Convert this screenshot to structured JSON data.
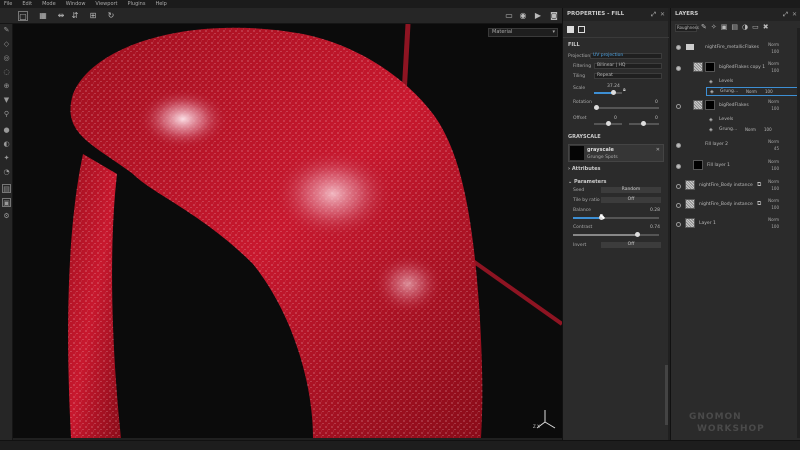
{
  "menu": [
    "File",
    "Edit",
    "Mode",
    "Window",
    "Viewport",
    "Plugins",
    "Help"
  ],
  "viewport": {
    "camera_select": "Material"
  },
  "properties": {
    "title": "PROPERTIES - FILL",
    "fill_section": "FILL",
    "projection_label": "Projection",
    "projection_value": "UV projection",
    "filtering_label": "Filtering",
    "filtering_value": "Bilinear | HQ",
    "tiling_label": "Tiling",
    "tiling_value": "Repeat",
    "scale_label": "Scale",
    "scale_value": "37.24",
    "rotation_label": "Rotation",
    "rotation_value": "0",
    "offset_label": "Offset",
    "offset_x": "0",
    "offset_y": "0",
    "grayscale_section": "GRAYSCALE",
    "grayscale_name": "grayscale",
    "grayscale_resource": "Grunge Spots",
    "attributes_label": "Attributes",
    "parameters_label": "Parameters",
    "seed_label": "Seed",
    "seed_button": "Random",
    "tile_by_ratio_label": "Tile by ratio",
    "tile_by_ratio_value": "Off",
    "balance_label": "Balance",
    "balance_value": "0.28",
    "contrast_label": "Contrast",
    "contrast_value": "0.74",
    "invert_label": "Invert",
    "invert_value": "Off"
  },
  "layers": {
    "title": "LAYERS",
    "channel_select": "Roughness",
    "items": [
      {
        "name": "nightFire_metallicFlakes",
        "blend": "Norm",
        "opacity": "100"
      },
      {
        "name": "bigRedFlakes copy 1",
        "blend": "Norm",
        "opacity": "100"
      },
      {
        "name": "Levels",
        "blend": "",
        "opacity": ""
      },
      {
        "name": "Grung...",
        "blend": "Norm",
        "opacity": "100"
      },
      {
        "name": "bigRedFlakes",
        "blend": "Norm",
        "opacity": "100"
      },
      {
        "name": "Levels",
        "blend": "",
        "opacity": ""
      },
      {
        "name": "Grung...",
        "blend": "Norm",
        "opacity": "100"
      },
      {
        "name": "Fill layer 2",
        "blend": "Norm",
        "opacity": "45"
      },
      {
        "name": "Fill layer 1",
        "blend": "Norm",
        "opacity": "100"
      },
      {
        "name": "nightFire_Body instance",
        "blend": "Norm",
        "opacity": "100"
      },
      {
        "name": "nightFire_Body instance",
        "blend": "Norm",
        "opacity": "100"
      },
      {
        "name": "Layer 1",
        "blend": "Norm",
        "opacity": "100"
      }
    ]
  },
  "watermark": {
    "line1": "GNOMON",
    "line2": "WORKSHOP"
  },
  "colors": {
    "accent": "#3d8fd4",
    "panel": "#2b2b2b",
    "paint": "#c0152b"
  }
}
